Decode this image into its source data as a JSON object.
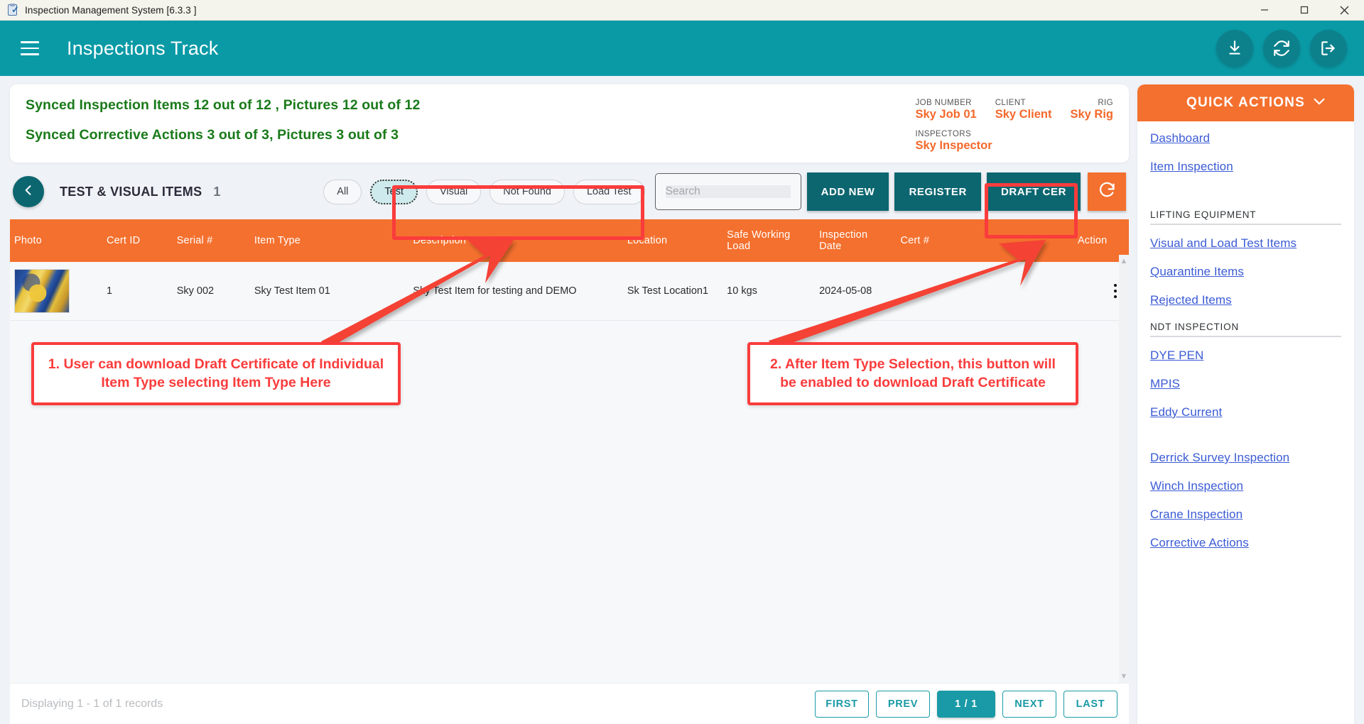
{
  "window": {
    "title": "Inspection Management System [6.3.3 ]",
    "icon": "clipboard-check-icon",
    "controls": {
      "minimize": "minimize-icon",
      "maximize": "maximize-icon",
      "close": "close-icon"
    }
  },
  "appbar": {
    "menu_icon": "hamburger-menu-icon",
    "title": "Inspections Track",
    "actions": [
      {
        "name": "download-button",
        "icon": "download-icon"
      },
      {
        "name": "sync-button",
        "icon": "sync-icon"
      },
      {
        "name": "logout-button",
        "icon": "logout-icon"
      }
    ],
    "bg_color": "#0a9aa6"
  },
  "sync_banner": {
    "line1": "Synced Inspection Items 12 out of 12 , Pictures 12 out of 12",
    "line2": "Synced Corrective Actions 3 out of 3, Pictures 3 out of 3",
    "text_color": "#1a7a1a"
  },
  "job_info": {
    "job_number_label": "JOB NUMBER",
    "job_number_value": "Sky Job 01",
    "client_label": "CLIENT",
    "client_value": "Sky Client",
    "rig_label": "RIG",
    "rig_value": "Sky Rig",
    "inspectors_label": "INSPECTORS",
    "inspectors_value": "Sky Inspector",
    "value_color": "#f4682a"
  },
  "toolbar": {
    "back_icon": "chevron-left-icon",
    "section_title": "TEST & VISUAL ITEMS",
    "section_count": "1",
    "chips": [
      {
        "label": "All",
        "selected": false
      },
      {
        "label": "Test",
        "selected": true
      },
      {
        "label": "Visual",
        "selected": false
      },
      {
        "label": "Not Found",
        "selected": false
      },
      {
        "label": "Load Test",
        "selected": false
      }
    ],
    "search_placeholder": "Search",
    "search_value": "",
    "add_new_label": "ADD NEW",
    "register_label": "REGISTER",
    "draft_cer_label": "DRAFT CER",
    "refresh_icon": "refresh-icon",
    "button_color": "#0c6670",
    "refresh_color": "#f4702e"
  },
  "table": {
    "header_color": "#f4702e",
    "columns": [
      "Photo",
      "Cert ID",
      "Serial #",
      "Item Type",
      "Description",
      "Location",
      "Safe Working Load",
      "Inspection Date",
      "Cert #",
      "",
      "Action"
    ],
    "rows": [
      {
        "photo": "item-thumbnail",
        "cert_id": "1",
        "serial": "Sky 002",
        "item_type": "Sky Test Item 01",
        "description": "Sky Test Item for testing and DEMO",
        "location": "Sk Test Location1",
        "swl": "10  kgs",
        "inspection_date": "2024-05-08",
        "cert_no": "",
        "blank": "",
        "action": "more-options-icon"
      }
    ]
  },
  "footer": {
    "records_text": "Displaying 1 - 1 of 1 records",
    "pager": {
      "first": "FIRST",
      "prev": "PREV",
      "current": "1  /  1",
      "next": "NEXT",
      "last": "LAST",
      "active_color": "#1a9aa6"
    }
  },
  "quick_actions": {
    "header": "QUICK ACTIONS",
    "chevron": "chevron-down-icon",
    "header_color": "#f4702e",
    "items": [
      {
        "type": "link",
        "label": "Dashboard"
      },
      {
        "type": "link",
        "label": "Item Inspection"
      },
      {
        "type": "gap"
      },
      {
        "type": "group",
        "label": "LIFTING EQUIPMENT"
      },
      {
        "type": "link",
        "label": "Visual and Load Test Items"
      },
      {
        "type": "link",
        "label": "Quarantine Items"
      },
      {
        "type": "link",
        "label": "Rejected Items"
      },
      {
        "type": "group",
        "label": "NDT INSPECTION"
      },
      {
        "type": "link",
        "label": "DYE PEN"
      },
      {
        "type": "link",
        "label": "MPIS"
      },
      {
        "type": "link",
        "label": "Eddy Current"
      },
      {
        "type": "gap"
      },
      {
        "type": "link",
        "label": "Derrick Survey Inspection"
      },
      {
        "type": "link",
        "label": "Winch Inspection"
      },
      {
        "type": "link",
        "label": "Crane Inspection"
      },
      {
        "type": "link",
        "label": "Corrective Actions"
      }
    ]
  },
  "annotations": {
    "color": "#fa3c3c",
    "note1": "1. User can download Draft Certificate of Individual Item Type selecting Item Type Here",
    "note2": "2. After Item Type Selection, this button will be enabled to download Draft Certificate"
  }
}
